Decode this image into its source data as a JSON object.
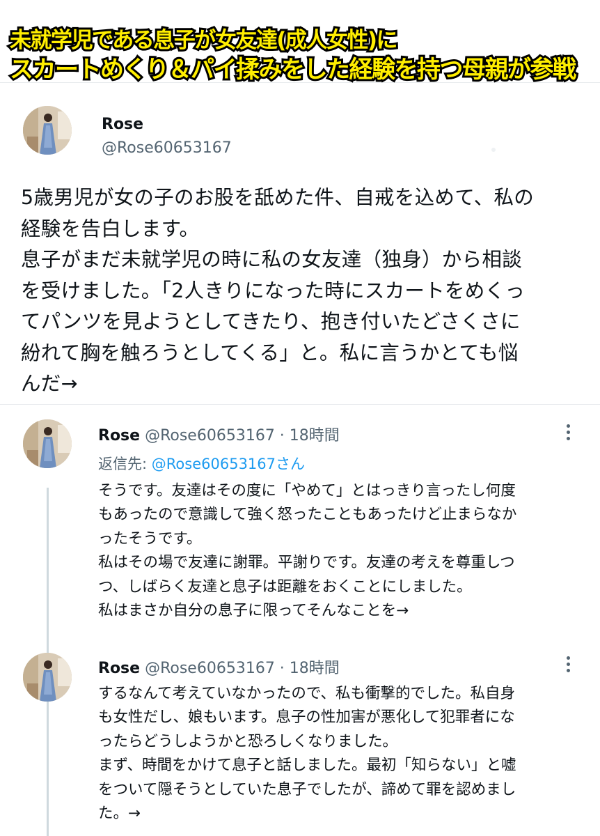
{
  "banner": {
    "line1": "未就学児である息子が女友達(成人女性)に",
    "line2": "スカートめくり＆パイ揉みをした経験を持つ母親が参戦"
  },
  "main_tweet": {
    "name": "Rose",
    "handle": "@Rose60653167",
    "body": "5歳男児が女の子のお股を舐めた件、自戒を込めて、私の\n経験を告白します。\n息子がまだ未就学児の時に私の女友達（独身）から相談\nを受けました。「2人きりになった時にスカートをめくっ\nてパンツを見ようとしてきたり、抱き付いたどさくさに\n紛れて胸を触ろうとしてくる」と。私に言うかとても悩\nんだ→"
  },
  "replies": [
    {
      "name": "Rose",
      "meta": "@Rose60653167 · 18時間",
      "replying_label": "返信先: ",
      "replying_mention": "@Rose60653167さん",
      "body": "そうです。友達はその度に「やめて」とはっきり言ったし何度\nもあったので意識して強く怒ったこともあったけど止まらなか\nったそうです。\n私はその場で友達に謝罪。平謝りです。友達の考えを尊重しつ\nつ、しばらく友達と息子は距離をおくことにしました。\n私はまさか自分の息子に限ってそんなことを→"
    },
    {
      "name": "Rose",
      "meta": "@Rose60653167 · 18時間",
      "body": "するなんて考えていなかったので、私も衝撃的でした。私自身\nも女性だし、娘もいます。息子の性加害が悪化して犯罪者にな\nったらどうしようかと恐ろしくなりました。\nまず、時間をかけて息子と話しました。最初「知らない」と嘘\nをついて隠そうとしていた息子でしたが、諦めて罪を認めまし\nた。→"
    }
  ],
  "colors": {
    "banner_text": "#ffee00",
    "banner_stroke": "#000000",
    "handle_gray": "#536471",
    "link_blue": "#1d9bf0",
    "divider": "#e8ebee"
  },
  "icons": [
    "avatar-photo",
    "more-options-icon"
  ]
}
